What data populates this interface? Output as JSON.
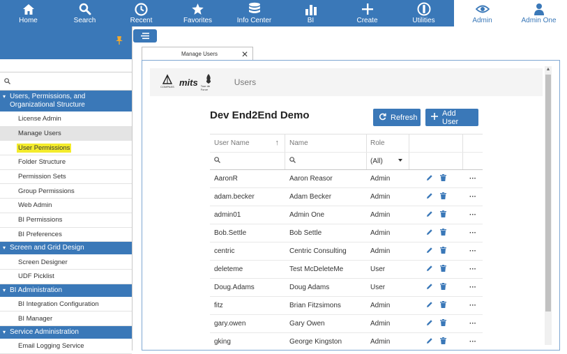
{
  "topnav": {
    "items": [
      {
        "label": "Home",
        "icon": "home-icon"
      },
      {
        "label": "Search",
        "icon": "search-icon"
      },
      {
        "label": "Recent",
        "icon": "clock-icon"
      },
      {
        "label": "Favorites",
        "icon": "star-icon"
      },
      {
        "label": "Info Center",
        "icon": "database-icon"
      },
      {
        "label": "BI",
        "icon": "bar-chart-icon"
      },
      {
        "label": "Create",
        "icon": "plus-icon"
      },
      {
        "label": "Utilities",
        "icon": "utilities-icon"
      }
    ],
    "right": [
      {
        "label": "Admin",
        "icon": "eye-icon"
      },
      {
        "label": "Admin One",
        "icon": "user-icon"
      }
    ]
  },
  "sidebar": {
    "sections": [
      {
        "title": "Users, Permissions, and Organizational Structure",
        "items": [
          "License Admin",
          "Manage Users",
          "User Permissions",
          "Folder Structure",
          "Permission Sets",
          "Group Permissions",
          "Web Admin",
          "BI Permissions",
          "BI Preferences"
        ]
      },
      {
        "title": "Screen and Grid Design",
        "items": [
          "Screen Designer",
          "UDF Picklist"
        ]
      },
      {
        "title": "BI Administration",
        "items": [
          "BI Integration Configuration",
          "BI Manager"
        ]
      },
      {
        "title": "Service Administration",
        "items": [
          "Email Logging Service"
        ]
      }
    ],
    "selected_item": "Manage Users",
    "highlighted_item": "User Permissions"
  },
  "tab": {
    "label": "Manage Users",
    "close": "✕"
  },
  "brand": {
    "page_title": "Users",
    "logo_compass": "COMPASS",
    "logo_mits": "mits",
    "logo_tdf": "Tour de Force"
  },
  "org_title": "Dev End2End Demo",
  "buttons": {
    "refresh": "Refresh",
    "add_user": "Add User"
  },
  "grid": {
    "headers": {
      "username": "User Name",
      "name": "Name",
      "role": "Role"
    },
    "filter": {
      "role_value": "(All)"
    },
    "rows": [
      {
        "username": "AaronR",
        "name": "Aaron Reasor",
        "role": "Admin"
      },
      {
        "username": "adam.becker",
        "name": "Adam Becker",
        "role": "Admin"
      },
      {
        "username": "admin01",
        "name": "Admin One",
        "role": "Admin"
      },
      {
        "username": "Bob.Settle",
        "name": "Bob Settle",
        "role": "Admin"
      },
      {
        "username": "centric",
        "name": "Centric Consulting",
        "role": "Admin"
      },
      {
        "username": "deleteme",
        "name": "Test McDeleteMe",
        "role": "User"
      },
      {
        "username": "Doug.Adams",
        "name": "Doug Adams",
        "role": "User"
      },
      {
        "username": "fitz",
        "name": "Brian Fitzsimons",
        "role": "Admin"
      },
      {
        "username": "gary.owen",
        "name": "Gary Owen",
        "role": "Admin"
      },
      {
        "username": "gking",
        "name": "George Kingston",
        "role": "Admin"
      }
    ],
    "more_label": "···"
  },
  "colors": {
    "primary": "#3a78b8",
    "highlight": "#f4ec2c",
    "pin": "#f0a830"
  }
}
